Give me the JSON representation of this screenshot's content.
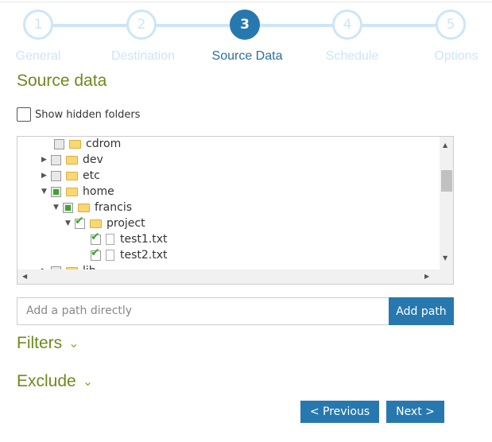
{
  "wizard": {
    "steps": [
      {
        "number": "1",
        "label": "General",
        "active": false
      },
      {
        "number": "2",
        "label": "Destination",
        "active": false
      },
      {
        "number": "3",
        "label": "Source Data",
        "active": true
      },
      {
        "number": "4",
        "label": "Schedule",
        "active": false
      },
      {
        "number": "5",
        "label": "Options",
        "active": false
      }
    ]
  },
  "section_title": "Source data",
  "show_hidden": {
    "label": "Show hidden folders",
    "checked": false
  },
  "tree": {
    "items": [
      {
        "name": "cdrom",
        "type": "folder",
        "state": "unchecked",
        "expander": "none"
      },
      {
        "name": "dev",
        "type": "folder",
        "state": "unchecked",
        "expander": "collapsed"
      },
      {
        "name": "etc",
        "type": "folder",
        "state": "unchecked",
        "expander": "collapsed"
      },
      {
        "name": "home",
        "type": "folder",
        "state": "partial",
        "expander": "expanded"
      },
      {
        "name": "francis",
        "type": "folder",
        "state": "partial",
        "expander": "expanded"
      },
      {
        "name": "project",
        "type": "folder",
        "state": "checked",
        "expander": "expanded"
      },
      {
        "name": "test1.txt",
        "type": "file",
        "state": "checked"
      },
      {
        "name": "test2.txt",
        "type": "file",
        "state": "checked"
      },
      {
        "name": "lib",
        "type": "folder",
        "state": "unchecked",
        "expander": "collapsed"
      }
    ]
  },
  "path_input": {
    "placeholder": "Add a path directly",
    "value": ""
  },
  "add_path_label": "Add path",
  "filters_label": "Filters",
  "exclude_label": "Exclude",
  "previous_label": "< Previous",
  "next_label": "Next >",
  "colors": {
    "accent": "#2878b0",
    "heading": "#6d8a1d",
    "inactive_step": "#cce6f7"
  }
}
